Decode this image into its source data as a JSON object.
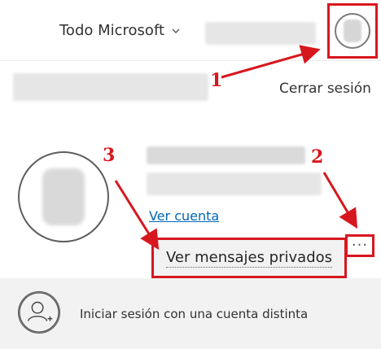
{
  "header": {
    "scope_label": "Todo Microsoft"
  },
  "account": {
    "sign_out_label": "Cerrar sesión",
    "view_account_label": "Ver cuenta",
    "more_options_glyph": "···"
  },
  "menu": {
    "private_messages_label": "Ver mensajes privados"
  },
  "footer": {
    "other_account_label": "Iniciar sesión con una cuenta distinta"
  },
  "annotations": {
    "step1": "1",
    "step2": "2",
    "step3": "3",
    "color": "#d7171e"
  },
  "colors": {
    "link": "#0067b8",
    "highlight": "#d7171e",
    "footer_bg": "#f2f2f2"
  }
}
